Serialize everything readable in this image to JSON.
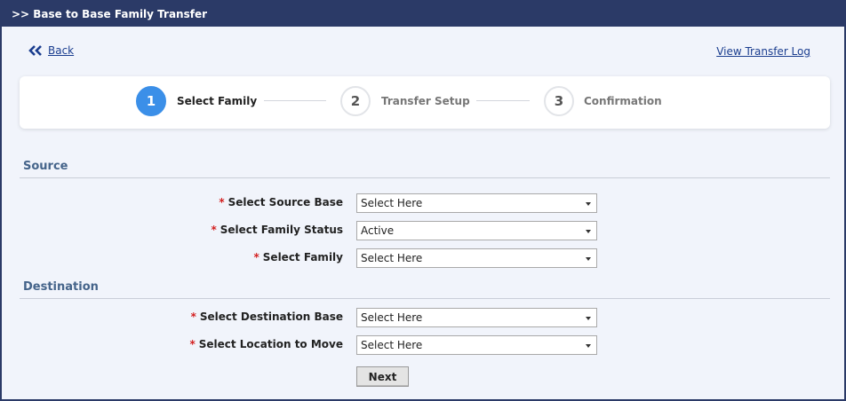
{
  "window": {
    "title": ">> Base to Base Family Transfer"
  },
  "nav": {
    "back_label": "Back",
    "log_link": "View Transfer Log"
  },
  "stepper": {
    "steps": [
      {
        "number": "1",
        "label": "Select Family",
        "state": "active"
      },
      {
        "number": "2",
        "label": "Transfer Setup",
        "state": "idle"
      },
      {
        "number": "3",
        "label": "Confirmation",
        "state": "idle"
      }
    ]
  },
  "source": {
    "title": "Source",
    "fields": [
      {
        "required_mark": "*",
        "label": "Select Source Base",
        "value": "Select Here"
      },
      {
        "required_mark": "*",
        "label": "Select Family Status",
        "value": "Active"
      },
      {
        "required_mark": "*",
        "label": "Select Family",
        "value": "Select Here"
      }
    ]
  },
  "destination": {
    "title": "Destination",
    "fields": [
      {
        "required_mark": "*",
        "label": "Select Destination Base",
        "value": "Select Here"
      },
      {
        "required_mark": "*",
        "label": "Select Location to Move",
        "value": "Select Here"
      }
    ]
  },
  "actions": {
    "next_label": "Next"
  },
  "colors": {
    "titlebar": "#2b3a67",
    "active_step": "#3b8fe8",
    "section_title": "#45648a",
    "required": "#d32020",
    "link": "#1a3d8f"
  },
  "icons": {
    "back": "double-chevron-left-icon",
    "dropdown": "chevron-down-icon"
  }
}
